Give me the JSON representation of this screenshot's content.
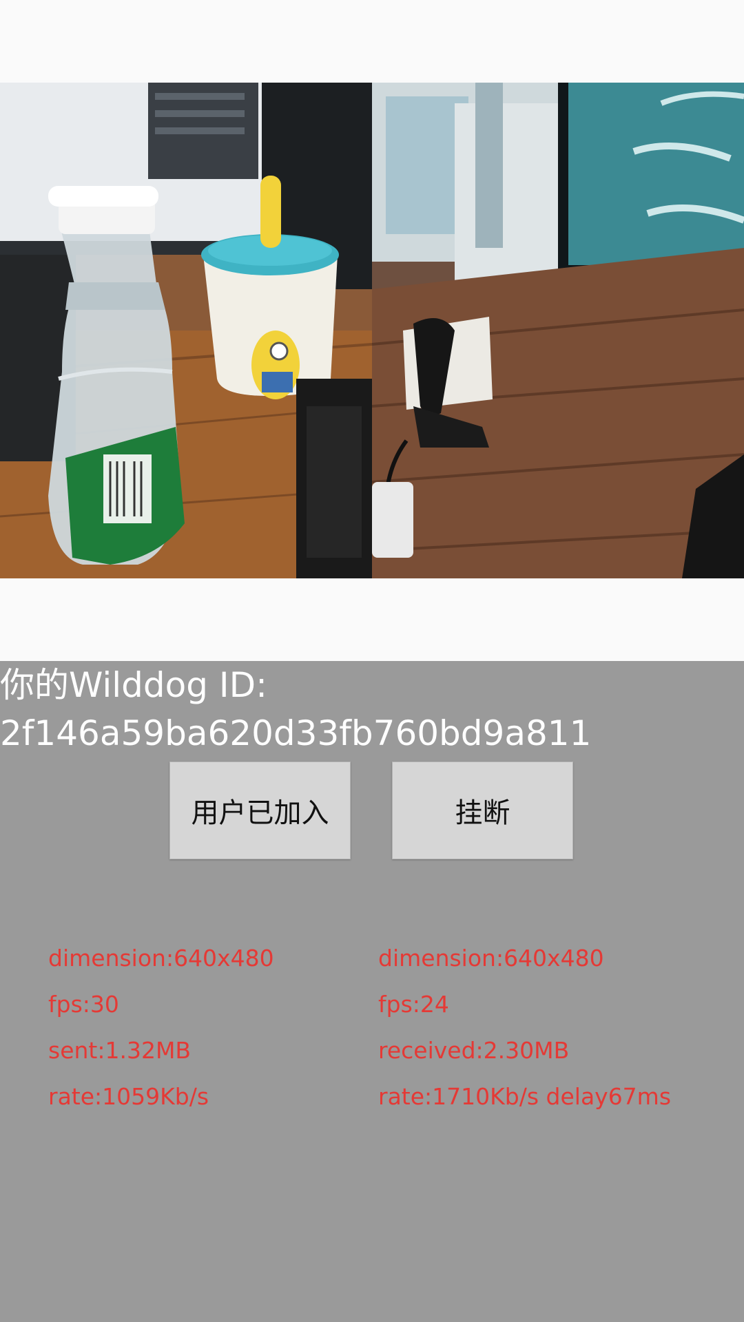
{
  "session": {
    "id_label": "你的Wilddog ID:",
    "id_value": "2f146a59ba620d33fb760bd9a811"
  },
  "buttons": {
    "join_label": "用户已加入",
    "hangup_label": "挂断"
  },
  "local_stats": {
    "dimension": "dimension:640x480",
    "fps": "fps:30",
    "sent": "sent:1.32MB",
    "rate": "rate:1059Kb/s"
  },
  "remote_stats": {
    "dimension": "dimension:640x480",
    "fps": "fps:24",
    "received": "received:2.30MB",
    "rate": "rate:1710Kb/s delay67ms"
  },
  "colors": {
    "panel_bg": "#9a9a9a",
    "stats_text": "#e53935",
    "id_text": "#ffffff",
    "button_bg": "#d6d6d6"
  }
}
